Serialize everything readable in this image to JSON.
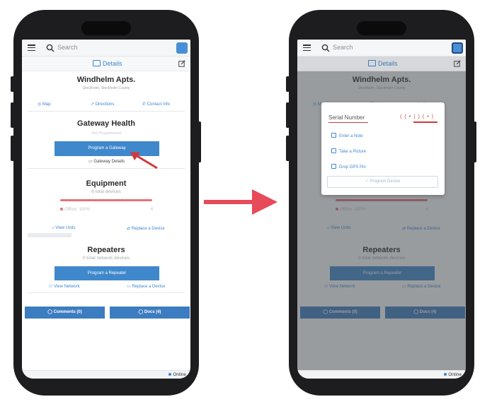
{
  "app": {
    "search_placeholder": "Search",
    "details_tab_label": "Details",
    "property_name": "Windhelm Apts.",
    "property_location": "Stockholm, Stockholm County",
    "links": {
      "map": "Map",
      "directions": "Directions",
      "contact_info": "Contact Info"
    },
    "gateway": {
      "title": "Gateway Health",
      "status": "Not Programmed",
      "program_button": "Program a Gateway",
      "details_link": "Gateway Details"
    },
    "equipment": {
      "title": "Equipment",
      "device_count": "6 total devices",
      "offline_label": "Offline",
      "offline_value": "100%",
      "offline_count": "6",
      "view_units": "View Units",
      "replace_device": "Replace a Device"
    },
    "repeaters": {
      "title": "Repeaters",
      "count": "0 total network devices",
      "program_button": "Program a Repeater",
      "view_network": "View Network",
      "replace_device": "Replace a Device"
    },
    "comments_button": "Comments (0)",
    "docs_button": "Docs (4)",
    "status": "Online"
  },
  "modal": {
    "serial_label": "Serial Number",
    "options": [
      "Enter a Note",
      "Take a Picture",
      "Drop GPS Pin"
    ],
    "program_button": "Program Device"
  },
  "colors": {
    "accent": "#3e86cf",
    "button": "#3f88cc",
    "annotation": "#d13a3a",
    "offline": "#e4737a"
  }
}
